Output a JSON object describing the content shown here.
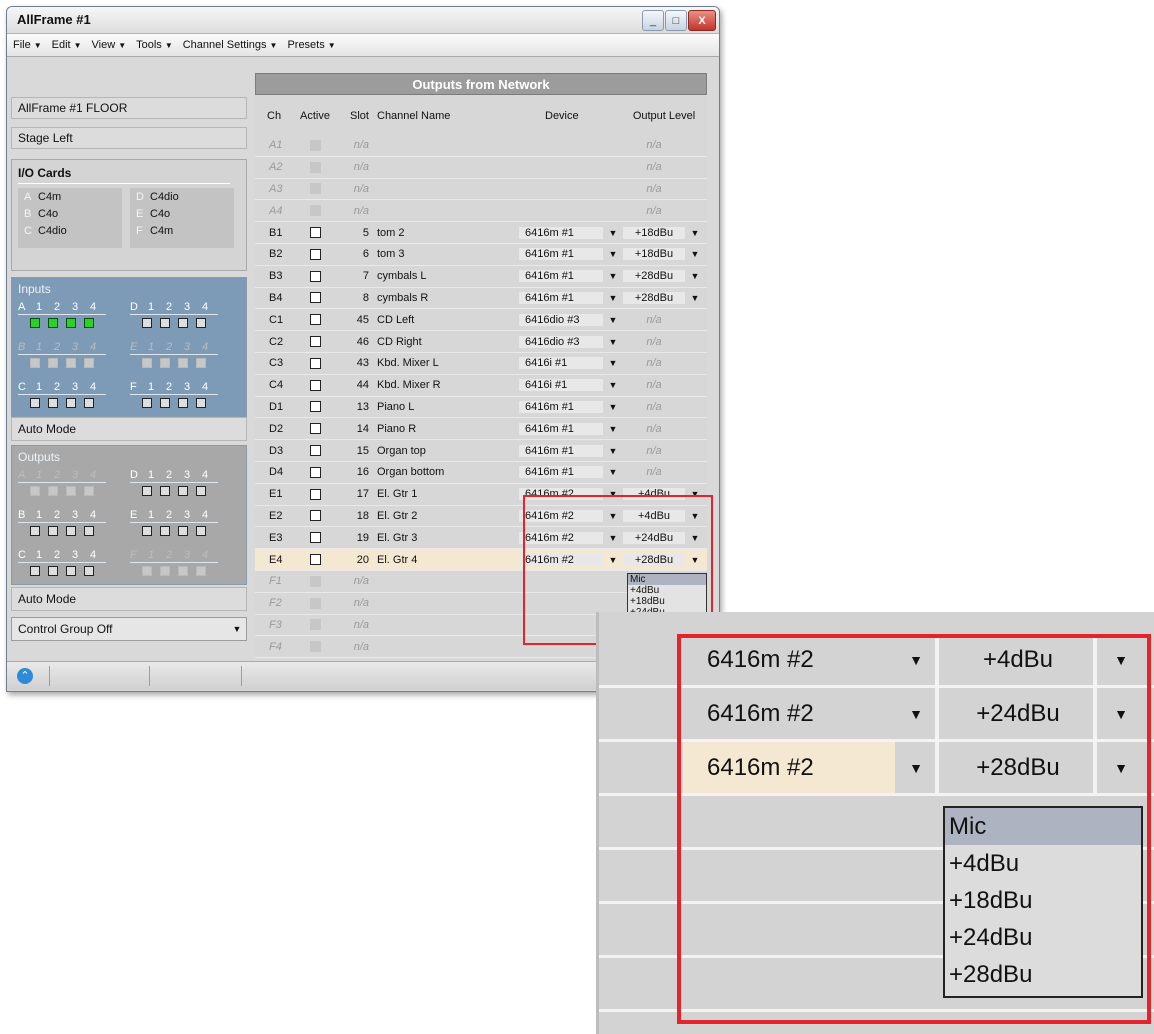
{
  "window": {
    "title": "AllFrame #1",
    "minimize": "_",
    "maximize": "□",
    "close": "X"
  },
  "menubar": [
    "File",
    "Edit",
    "View",
    "Tools",
    "Channel Settings",
    "Presets"
  ],
  "left_panel": {
    "frame_label": "AllFrame #1 FLOOR",
    "location_label": "Stage Left",
    "io_cards": {
      "title": "I/O Cards",
      "left": [
        {
          "letter": "A",
          "card": "C4m"
        },
        {
          "letter": "B",
          "card": "C4o"
        },
        {
          "letter": "C",
          "card": "C4dio"
        }
      ],
      "right": [
        {
          "letter": "D",
          "card": "C4dio"
        },
        {
          "letter": "E",
          "card": "C4o"
        },
        {
          "letter": "F",
          "card": "C4m"
        }
      ]
    },
    "inputs_title": "Inputs",
    "inputs_mode": "Auto Mode",
    "outputs_title": "Outputs",
    "outputs_mode": "Auto Mode",
    "control_group": "Control Group Off",
    "channel_numbers": [
      "1",
      "2",
      "3",
      "4"
    ]
  },
  "table": {
    "title": "Outputs from Network",
    "headers": {
      "ch": "Ch",
      "active": "Active",
      "slot": "Slot",
      "name": "Channel Name",
      "device": "Device",
      "output": "Output Level"
    },
    "rows": [
      {
        "ch": "A1",
        "active": "disabled",
        "slot": "n/a",
        "name": "",
        "device": "",
        "output": "n/a"
      },
      {
        "ch": "A2",
        "active": "disabled",
        "slot": "n/a",
        "name": "",
        "device": "",
        "output": "n/a"
      },
      {
        "ch": "A3",
        "active": "disabled",
        "slot": "n/a",
        "name": "",
        "device": "",
        "output": "n/a"
      },
      {
        "ch": "A4",
        "active": "disabled",
        "slot": "n/a",
        "name": "",
        "device": "",
        "output": "n/a"
      },
      {
        "ch": "B1",
        "active": "off",
        "slot": "5",
        "name": "tom 2",
        "device": "6416m #1",
        "output": "+18dBu"
      },
      {
        "ch": "B2",
        "active": "off",
        "slot": "6",
        "name": "tom 3",
        "device": "6416m #1",
        "output": "+18dBu"
      },
      {
        "ch": "B3",
        "active": "off",
        "slot": "7",
        "name": "cymbals L",
        "device": "6416m #1",
        "output": "+28dBu"
      },
      {
        "ch": "B4",
        "active": "off",
        "slot": "8",
        "name": "cymbals R",
        "device": "6416m #1",
        "output": "+28dBu"
      },
      {
        "ch": "C1",
        "active": "off",
        "slot": "45",
        "name": "CD Left",
        "device": "6416dio #3",
        "output": "n/a"
      },
      {
        "ch": "C2",
        "active": "off",
        "slot": "46",
        "name": "CD Right",
        "device": "6416dio #3",
        "output": "n/a"
      },
      {
        "ch": "C3",
        "active": "off",
        "slot": "43",
        "name": "Kbd. Mixer L",
        "device": "6416i #1",
        "output": "n/a"
      },
      {
        "ch": "C4",
        "active": "off",
        "slot": "44",
        "name": "Kbd. Mixer R",
        "device": "6416i #1",
        "output": "n/a"
      },
      {
        "ch": "D1",
        "active": "off",
        "slot": "13",
        "name": "Piano L",
        "device": "6416m #1",
        "output": "n/a"
      },
      {
        "ch": "D2",
        "active": "off",
        "slot": "14",
        "name": "Piano R",
        "device": "6416m #1",
        "output": "n/a"
      },
      {
        "ch": "D3",
        "active": "off",
        "slot": "15",
        "name": "Organ top",
        "device": "6416m #1",
        "output": "n/a"
      },
      {
        "ch": "D4",
        "active": "off",
        "slot": "16",
        "name": "Organ bottom",
        "device": "6416m #1",
        "output": "n/a"
      },
      {
        "ch": "E1",
        "active": "off",
        "slot": "17",
        "name": "El. Gtr 1",
        "device": "6416m #2",
        "output": "+4dBu"
      },
      {
        "ch": "E2",
        "active": "off",
        "slot": "18",
        "name": "El. Gtr 2",
        "device": "6416m #2",
        "output": "+4dBu"
      },
      {
        "ch": "E3",
        "active": "off",
        "slot": "19",
        "name": "El. Gtr 3",
        "device": "6416m #2",
        "output": "+24dBu"
      },
      {
        "ch": "E4",
        "active": "off",
        "slot": "20",
        "name": "El. Gtr 4",
        "device": "6416m #2",
        "output": "+28dBu"
      },
      {
        "ch": "F1",
        "active": "disabled",
        "slot": "n/a",
        "name": "",
        "device": "",
        "output": ""
      },
      {
        "ch": "F2",
        "active": "disabled",
        "slot": "n/a",
        "name": "",
        "device": "",
        "output": ""
      },
      {
        "ch": "F3",
        "active": "disabled",
        "slot": "n/a",
        "name": "",
        "device": "",
        "output": ""
      },
      {
        "ch": "F4",
        "active": "disabled",
        "slot": "n/a",
        "name": "",
        "device": "",
        "output": ""
      }
    ],
    "output_level_options": [
      "Mic",
      "+4dBu",
      "+18dBu",
      "+24dBu",
      "+28dBu"
    ],
    "highlighted_option": "Mic"
  },
  "zoom_callout": {
    "rows": [
      {
        "device": "6416m #2",
        "output": "+4dBu"
      },
      {
        "device": "6416m #2",
        "output": "+24dBu"
      },
      {
        "device": "6416m #2",
        "output": "+28dBu"
      }
    ],
    "options": [
      "Mic",
      "+4dBu",
      "+18dBu",
      "+24dBu",
      "+28dBu"
    ]
  },
  "colors": {
    "accent_red": "#e4232a",
    "inputs_panel": "#7d9bb6",
    "active_green": "#2bd12b",
    "selected_row": "#f5e8d3"
  }
}
